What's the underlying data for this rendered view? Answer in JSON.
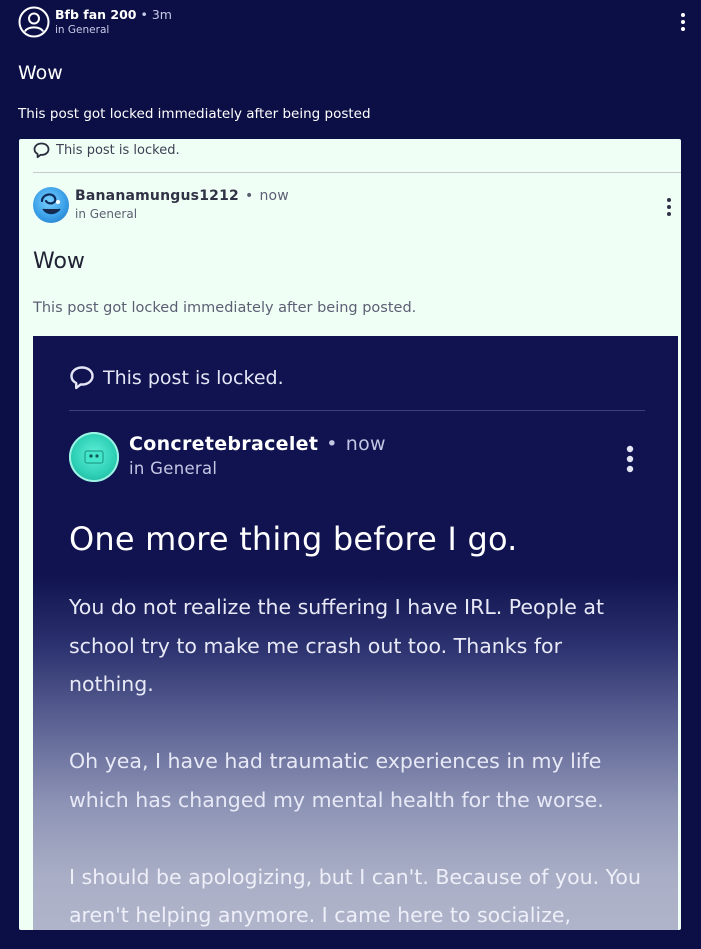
{
  "post": {
    "author": "Bfb fan 200",
    "separator": "•",
    "time": "3m",
    "community": "in General",
    "title": "Wow",
    "body": "This post got locked immediately after being posted",
    "avatar_icon": "user-circle-icon",
    "more_icon": "more-vertical-icon"
  },
  "screenshot": {
    "locked_notice": "This post is locked.",
    "lock_icon": "speech-bubble-icon",
    "post": {
      "author": "Bananamungus1212",
      "separator": "•",
      "time": "now",
      "community": "in General",
      "title": "Wow",
      "body": "This post got locked immediately after being posted.",
      "more_icon": "more-vertical-icon"
    },
    "nested_screenshot": {
      "locked_notice": "This post is locked.",
      "lock_icon": "speech-bubble-icon",
      "post": {
        "author": "Concretebracelet",
        "separator": "•",
        "time": "now",
        "community": "in General",
        "title": "One more thing before I go.",
        "paragraphs": [
          "You do not realize the suffering I have IRL. People at school try to make me crash out too. Thanks for nothing.",
          "Oh yea, I have had traumatic experiences in my life which has changed my mental health for the worse.",
          "I should be apologizing, but I can't. Because of you. You aren't helping anymore. I came here to socialize,"
        ],
        "more_icon": "more-vertical-icon"
      }
    }
  },
  "colors": {
    "background": "#0c0f45",
    "screenshot_background": "#f0fff5",
    "nested_background": "#10134f"
  }
}
